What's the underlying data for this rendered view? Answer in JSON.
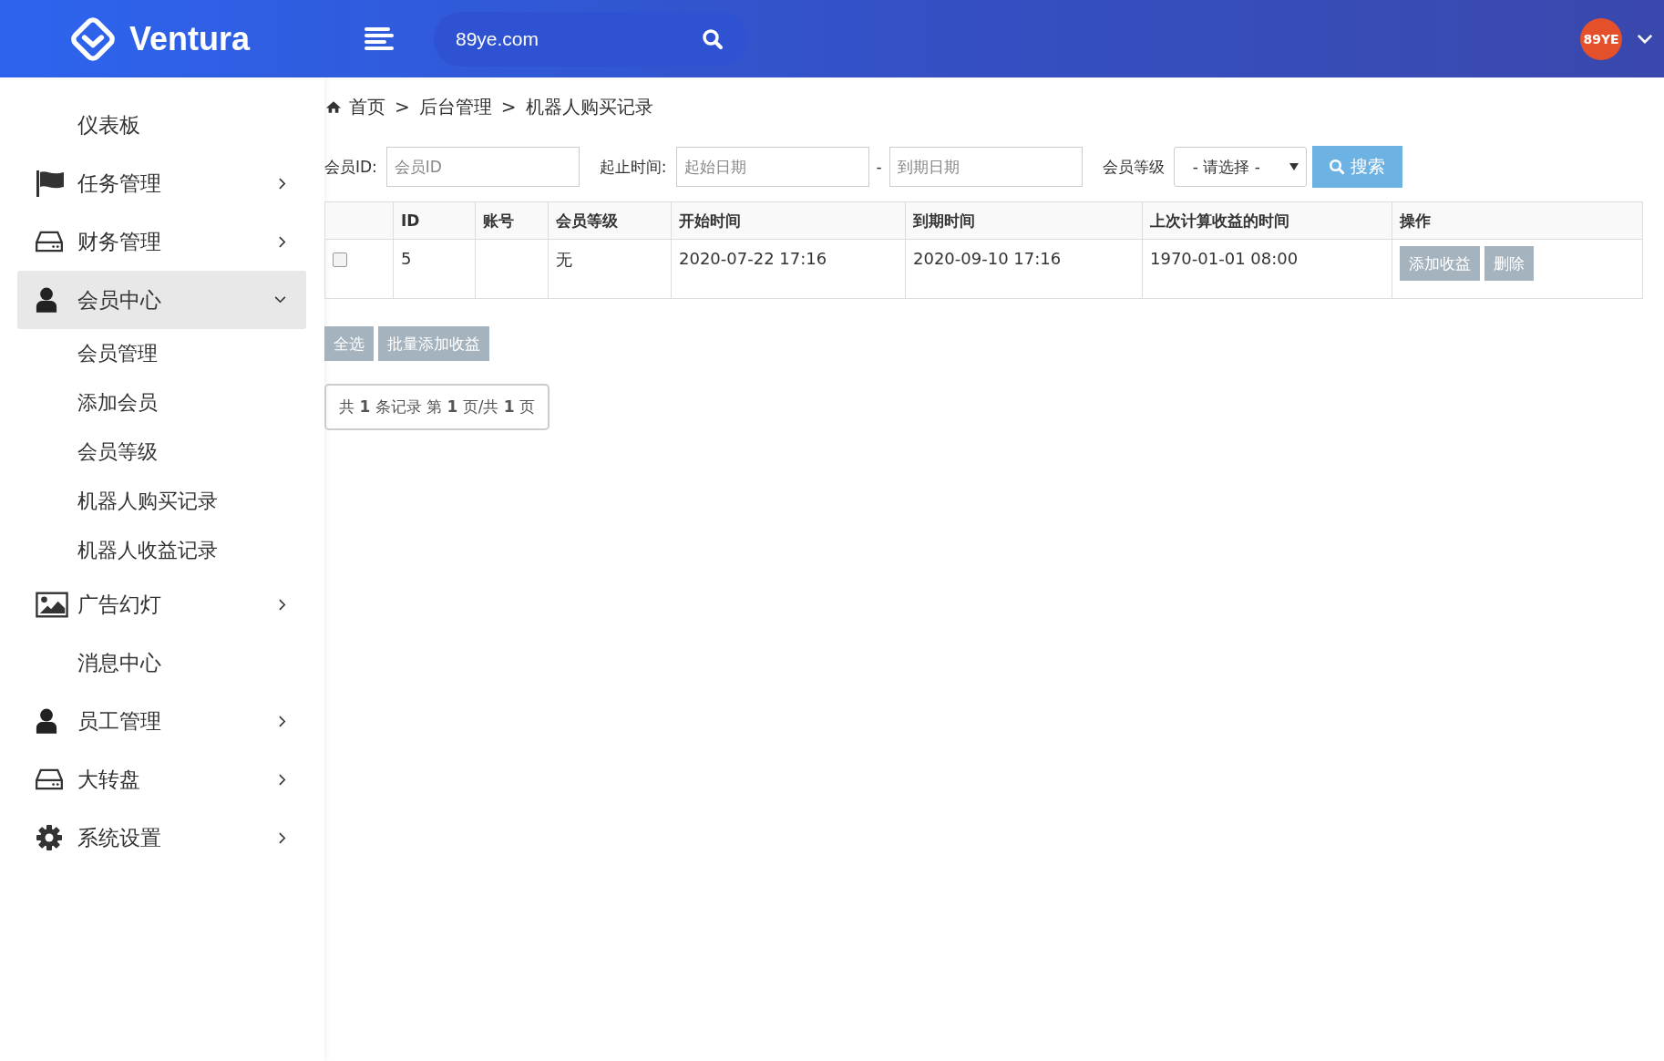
{
  "header": {
    "brand": "Ventura",
    "search": {
      "value": "89ye.com"
    },
    "avatar_text": "89YE"
  },
  "sidebar": {
    "items": [
      {
        "label": "仪表板",
        "kind": "plain",
        "selected": false
      },
      {
        "label": "任务管理",
        "kind": "flag",
        "selected": false,
        "expanded": false
      },
      {
        "label": "财务管理",
        "kind": "drive",
        "selected": false,
        "expanded": false
      },
      {
        "label": "会员中心",
        "kind": "user",
        "selected": true,
        "expanded": true,
        "children": [
          {
            "label": "会员管理"
          },
          {
            "label": "添加会员"
          },
          {
            "label": "会员等级"
          },
          {
            "label": "机器人购买记录"
          },
          {
            "label": "机器人收益记录"
          }
        ]
      },
      {
        "label": "广告幻灯",
        "kind": "image",
        "selected": false,
        "expanded": false
      },
      {
        "label": "消息中心",
        "kind": "plain",
        "selected": false
      },
      {
        "label": "员工管理",
        "kind": "user",
        "selected": false,
        "expanded": false
      },
      {
        "label": "大转盘",
        "kind": "drive",
        "selected": false,
        "expanded": false
      },
      {
        "label": "系统设置",
        "kind": "gear",
        "selected": false,
        "expanded": false
      }
    ]
  },
  "breadcrumb": [
    "首页",
    "后台管理",
    "机器人购买记录"
  ],
  "breadcrumb_separator": ">",
  "filters": {
    "member_id_label": "会员ID:",
    "member_id_placeholder": "会员ID",
    "date_label": "起止时间:",
    "start_placeholder": "起始日期",
    "range_dash": "-",
    "end_placeholder": "到期日期",
    "level_label": "会员等级",
    "level_value": "- 请选择 -",
    "search_button": "搜索"
  },
  "table": {
    "columns": [
      "",
      "ID",
      "账号",
      "会员等级",
      "开始时间",
      "到期时间",
      "上次计算收益的时间",
      "操作"
    ],
    "rows": [
      {
        "checked": false,
        "cells": [
          "",
          "5",
          "",
          "无",
          "2020-07-22 17:16",
          "2020-09-10 17:16",
          "1970-01-01 08:00"
        ],
        "actions": [
          "添加收益",
          "删除"
        ]
      }
    ]
  },
  "bulk_buttons": [
    "全选",
    "批量添加收益"
  ],
  "pagination": "共 **1** 条记录 第 **1** 页/共 **1** 页"
}
